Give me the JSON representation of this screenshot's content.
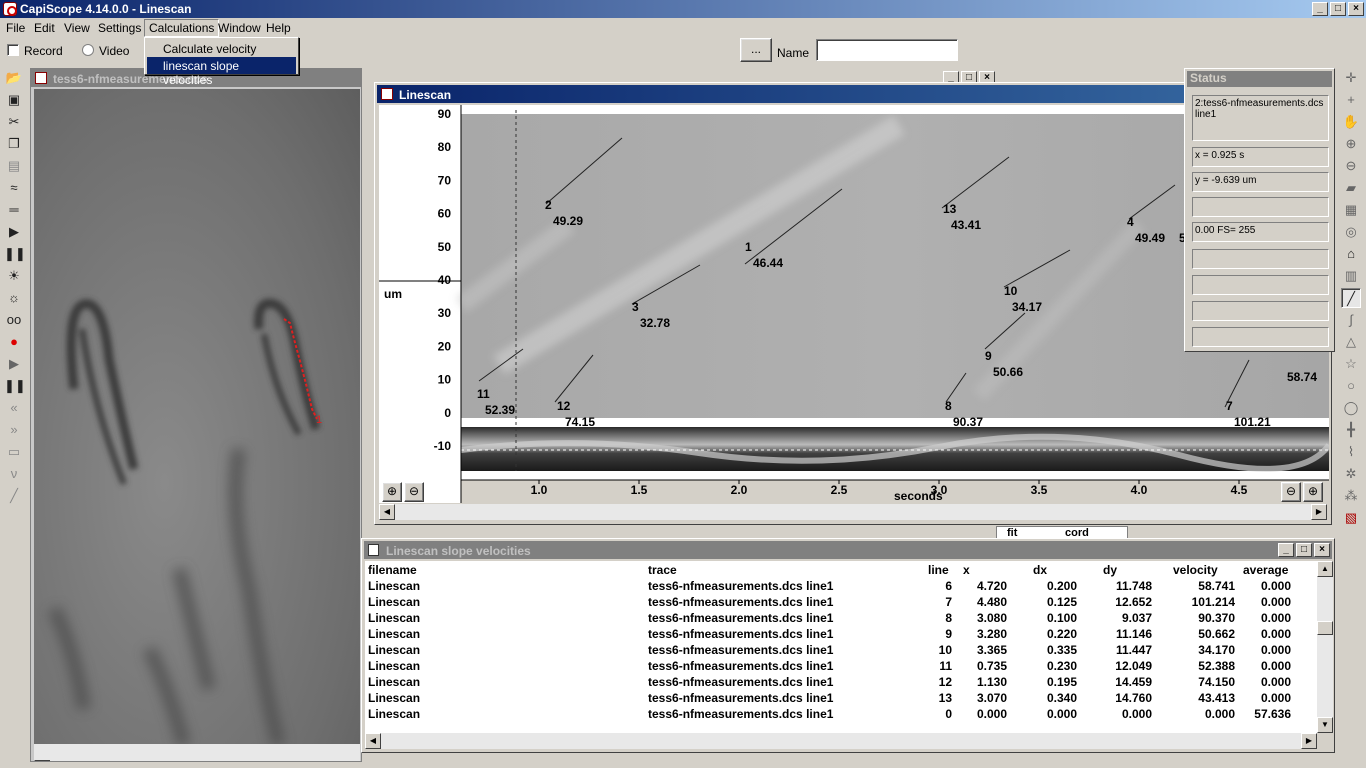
{
  "app": {
    "title": "CapiScope 4.14.0.0 - Linescan"
  },
  "menu": [
    "File",
    "Edit",
    "View",
    "Settings",
    "Calculations",
    "Window",
    "Help"
  ],
  "dropdown": [
    "Calculate velocity",
    "linescan slope velocities"
  ],
  "recordbar": {
    "record": "Record",
    "video": "Video",
    "ellipsis": "...",
    "name_label": "Name",
    "name_value": ""
  },
  "image_window": {
    "title": "tess6-nfmeasurements.dcs",
    "marker": "1"
  },
  "linescan": {
    "title": "Linescan",
    "unit": "um",
    "xlabel": "seconds",
    "yticks": [
      "90",
      "80",
      "70",
      "60",
      "50",
      "40",
      "30",
      "20",
      "10",
      "0",
      "-10"
    ],
    "xticks": [
      "1.0",
      "1.5",
      "2.0",
      "2.5",
      "3.0",
      "3.5",
      "4.0",
      "4.5"
    ],
    "labels": [
      {
        "n": "2",
        "v": "49.29"
      },
      {
        "n": "1",
        "v": "46.44"
      },
      {
        "n": "3",
        "v": "32.78"
      },
      {
        "n": "11",
        "v": "52.39"
      },
      {
        "n": "12",
        "v": "74.15"
      },
      {
        "n": "13",
        "v": "43.41"
      },
      {
        "n": "10",
        "v": "34.17"
      },
      {
        "n": "9",
        "v": "50.66"
      },
      {
        "n": "8",
        "v": "90.37"
      },
      {
        "n": "4",
        "v": "49.49"
      },
      {
        "n": "7",
        "v": "101.21"
      },
      {
        "n": "",
        "v": "58.74"
      }
    ],
    "partial_label": "5"
  },
  "status": {
    "title": "Status",
    "file": "2:tess6-nfmeasurements.dcs",
    "line": "line1",
    "x": "x = 0.925 s",
    "y": "y = -9.639 um",
    "fs": "0.00 FS=  255"
  },
  "behind_tabs": {
    "fit": "fit",
    "cord": "cord"
  },
  "table": {
    "title": "Linescan slope velocities",
    "headers": [
      "filename",
      "trace",
      "line",
      "x",
      "dx",
      "dy",
      "velocity",
      "average"
    ],
    "rows": [
      [
        "Linescan",
        "tess6-nfmeasurements.dcs line1",
        "6",
        "4.720",
        "0.200",
        "11.748",
        "58.741",
        "0.000"
      ],
      [
        "Linescan",
        "tess6-nfmeasurements.dcs line1",
        "7",
        "4.480",
        "0.125",
        "12.652",
        "101.214",
        "0.000"
      ],
      [
        "Linescan",
        "tess6-nfmeasurements.dcs line1",
        "8",
        "3.080",
        "0.100",
        "9.037",
        "90.370",
        "0.000"
      ],
      [
        "Linescan",
        "tess6-nfmeasurements.dcs line1",
        "9",
        "3.280",
        "0.220",
        "11.146",
        "50.662",
        "0.000"
      ],
      [
        "Linescan",
        "tess6-nfmeasurements.dcs line1",
        "10",
        "3.365",
        "0.335",
        "11.447",
        "34.170",
        "0.000"
      ],
      [
        "Linescan",
        "tess6-nfmeasurements.dcs line1",
        "11",
        "0.735",
        "0.230",
        "12.049",
        "52.388",
        "0.000"
      ],
      [
        "Linescan",
        "tess6-nfmeasurements.dcs line1",
        "12",
        "1.130",
        "0.195",
        "14.459",
        "74.150",
        "0.000"
      ],
      [
        "Linescan",
        "tess6-nfmeasurements.dcs line1",
        "13",
        "3.070",
        "0.340",
        "14.760",
        "43.413",
        "0.000"
      ],
      [
        "Linescan",
        "tess6-nfmeasurements.dcs line1",
        "0",
        "0.000",
        "0.000",
        "0.000",
        "0.000",
        "57.636"
      ]
    ]
  }
}
